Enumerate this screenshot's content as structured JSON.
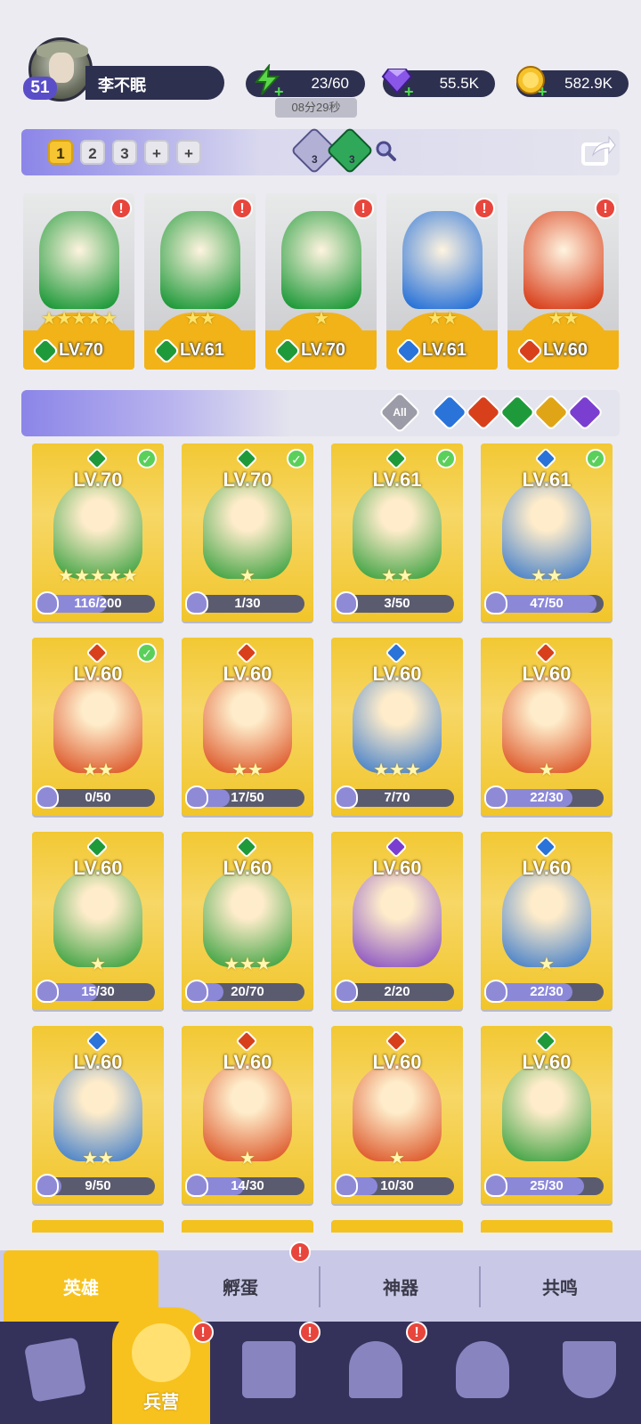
{
  "player": {
    "level": "51",
    "name": "李不眠"
  },
  "resources": {
    "energy": "23/60",
    "energy_timer": "08分29秒",
    "gems": "55.5K",
    "coins": "582.9K"
  },
  "team": {
    "slots": [
      "1",
      "2",
      "3",
      "+",
      "+"
    ],
    "active_slot": "1",
    "resource_a_count": "3",
    "resource_b_count": "3"
  },
  "top_heroes": [
    {
      "level": "LV.70",
      "stars": "★★★★★",
      "element": "green",
      "alert": "!"
    },
    {
      "level": "LV.61",
      "stars": "★★",
      "element": "green",
      "alert": "!"
    },
    {
      "level": "LV.70",
      "stars": "★",
      "element": "green",
      "alert": "!"
    },
    {
      "level": "LV.61",
      "stars": "★★",
      "element": "blue",
      "alert": "!"
    },
    {
      "level": "LV.60",
      "stars": "★★",
      "element": "red",
      "alert": "!"
    }
  ],
  "filter": {
    "all_label": "All",
    "elements": [
      "blue",
      "red",
      "green",
      "gold",
      "purple"
    ]
  },
  "heroes": [
    {
      "level": "LV.70",
      "progress": "116/200",
      "fraction": 0.58,
      "element": "green",
      "equipped": true,
      "stars": "★★★★★"
    },
    {
      "level": "LV.70",
      "progress": "1/30",
      "fraction": 0.03,
      "element": "green",
      "equipped": true,
      "stars": "★"
    },
    {
      "level": "LV.61",
      "progress": "3/50",
      "fraction": 0.06,
      "element": "green",
      "equipped": true,
      "stars": "★★"
    },
    {
      "level": "LV.61",
      "progress": "47/50",
      "fraction": 0.94,
      "element": "blue",
      "equipped": true,
      "stars": "★★"
    },
    {
      "level": "LV.60",
      "progress": "0/50",
      "fraction": 0.0,
      "element": "red",
      "equipped": true,
      "stars": "★★"
    },
    {
      "level": "LV.60",
      "progress": "17/50",
      "fraction": 0.34,
      "element": "red",
      "equipped": false,
      "stars": "★★"
    },
    {
      "level": "LV.60",
      "progress": "7/70",
      "fraction": 0.1,
      "element": "blue",
      "equipped": false,
      "stars": "★★★"
    },
    {
      "level": "LV.60",
      "progress": "22/30",
      "fraction": 0.73,
      "element": "red",
      "equipped": false,
      "stars": "★"
    },
    {
      "level": "LV.60",
      "progress": "15/30",
      "fraction": 0.5,
      "element": "green",
      "equipped": false,
      "stars": "★"
    },
    {
      "level": "LV.60",
      "progress": "20/70",
      "fraction": 0.29,
      "element": "green",
      "equipped": false,
      "stars": "★★★"
    },
    {
      "level": "LV.60",
      "progress": "2/20",
      "fraction": 0.1,
      "element": "purple",
      "equipped": false,
      "stars": ""
    },
    {
      "level": "LV.60",
      "progress": "22/30",
      "fraction": 0.73,
      "element": "blue",
      "equipped": false,
      "stars": "★"
    },
    {
      "level": "LV.60",
      "progress": "9/50",
      "fraction": 0.18,
      "element": "blue",
      "equipped": false,
      "stars": "★★"
    },
    {
      "level": "LV.60",
      "progress": "14/30",
      "fraction": 0.47,
      "element": "red",
      "equipped": false,
      "stars": "★"
    },
    {
      "level": "LV.60",
      "progress": "10/30",
      "fraction": 0.33,
      "element": "red",
      "equipped": false,
      "stars": "★"
    },
    {
      "level": "LV.60",
      "progress": "25/30",
      "fraction": 0.83,
      "element": "green",
      "equipped": false,
      "stars": ""
    }
  ],
  "subtabs": [
    {
      "label": "英雄",
      "active": true,
      "alert": false
    },
    {
      "label": "孵蛋",
      "active": false,
      "alert": true
    },
    {
      "label": "神器",
      "active": false,
      "alert": false
    },
    {
      "label": "共鸣",
      "active": false,
      "alert": false
    }
  ],
  "bottom_nav": [
    {
      "icon": "cards-icon",
      "label": "",
      "alert": false
    },
    {
      "icon": "barracks-icon",
      "label": "兵营",
      "alert": true,
      "active": true
    },
    {
      "icon": "map-icon",
      "label": "",
      "alert": true
    },
    {
      "icon": "castle-icon",
      "label": "",
      "alert": true
    },
    {
      "icon": "mushroom-icon",
      "label": "",
      "alert": false
    },
    {
      "icon": "guild-banner-icon",
      "label": "",
      "alert": false
    }
  ],
  "colors": {
    "green": "#1f9a3a",
    "blue": "#2a73d8",
    "red": "#d8401c",
    "gold": "#e0a516",
    "purple": "#7a3fd0",
    "card_gold": "#f4c21e",
    "nav_bg": "#34325a"
  }
}
